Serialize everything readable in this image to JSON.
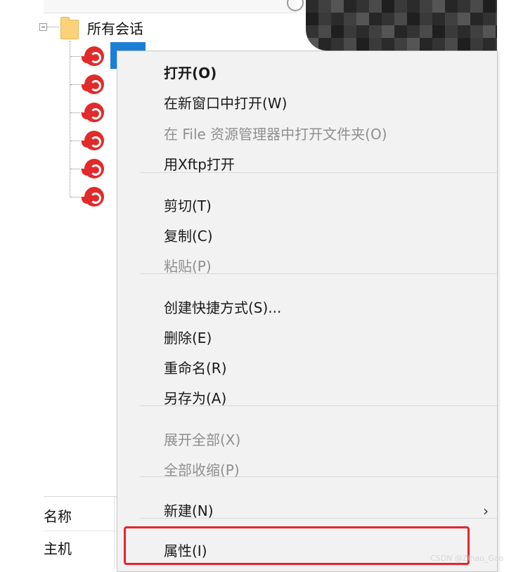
{
  "tree": {
    "root_label": "所有会话",
    "session_count": 6
  },
  "context_menu": {
    "items": [
      {
        "label": "打开(O)",
        "enabled": true,
        "default": true
      },
      {
        "label": "在新窗口中打开(W)",
        "enabled": true
      },
      {
        "label": "在 File 资源管理器中打开文件夹(O)",
        "enabled": false
      },
      {
        "label": "用Xftp打开",
        "enabled": true
      },
      {
        "label": "剪切(T)",
        "enabled": true
      },
      {
        "label": "复制(C)",
        "enabled": true
      },
      {
        "label": "粘贴(P)",
        "enabled": false
      },
      {
        "label": "创建快捷方式(S)...",
        "enabled": true
      },
      {
        "label": "删除(E)",
        "enabled": true
      },
      {
        "label": "重命名(R)",
        "enabled": true
      },
      {
        "label": "另存为(A)",
        "enabled": true
      },
      {
        "label": "展开全部(X)",
        "enabled": false
      },
      {
        "label": "全部收缩(P)",
        "enabled": false
      },
      {
        "label": "新建(N)",
        "enabled": true,
        "submenu_arrow": "›"
      },
      {
        "label": "属性(I)",
        "enabled": true,
        "highlighted": true
      }
    ]
  },
  "properties_pane": {
    "row1": "名称",
    "row2": "主机"
  },
  "icons": {
    "folder": "folder-icon",
    "session": "xshell-session-icon",
    "search": "search-icon"
  },
  "colors": {
    "highlight_border": "#e8242b",
    "selection": "#1a7fd6",
    "session_icon": "#e22a2a",
    "menu_background": "#f2f2f2"
  },
  "watermark": "CSDN @Zihao_Gao"
}
